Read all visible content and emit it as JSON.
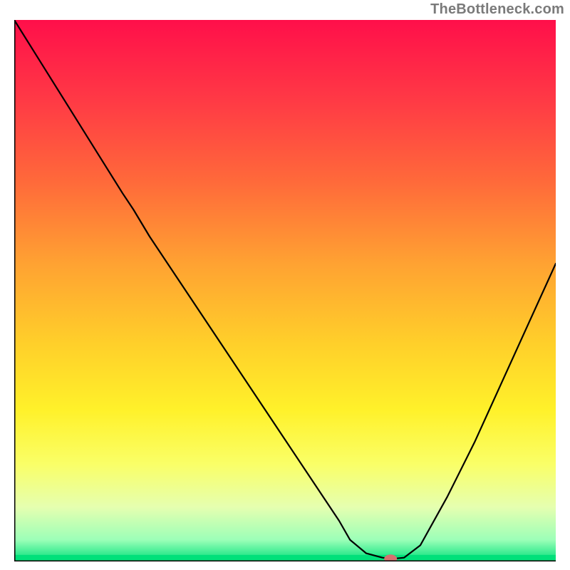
{
  "attribution": "TheBottleneck.com",
  "chart_data": {
    "type": "line",
    "title": "",
    "xlabel": "",
    "ylabel": "",
    "xlim": [
      0,
      100
    ],
    "ylim": [
      0,
      100
    ],
    "grid": false,
    "legend": false,
    "series": [
      {
        "name": "bottleneck-curve",
        "x": [
          0,
          5,
          10,
          15,
          20,
          22,
          25,
          30,
          35,
          40,
          45,
          50,
          55,
          60,
          62,
          65,
          68,
          70,
          72,
          75,
          80,
          85,
          90,
          95,
          100
        ],
        "y": [
          100,
          92,
          84,
          76,
          68,
          65,
          60,
          52.5,
          45,
          37.5,
          30,
          22.5,
          15,
          7.5,
          4,
          1.5,
          0.7,
          0.5,
          0.7,
          3,
          12,
          22,
          33,
          44,
          55
        ]
      }
    ],
    "marker": {
      "x": 69.5,
      "y": 0.5,
      "color": "#d4706f"
    },
    "gradient_stops": [
      {
        "offset": 0.0,
        "color": "#ff0f4a"
      },
      {
        "offset": 0.15,
        "color": "#ff3a45"
      },
      {
        "offset": 0.3,
        "color": "#ff6a3a"
      },
      {
        "offset": 0.45,
        "color": "#ffa232"
      },
      {
        "offset": 0.6,
        "color": "#ffd02a"
      },
      {
        "offset": 0.72,
        "color": "#fff12a"
      },
      {
        "offset": 0.82,
        "color": "#faff67"
      },
      {
        "offset": 0.9,
        "color": "#e5ffb0"
      },
      {
        "offset": 0.96,
        "color": "#9cffb8"
      },
      {
        "offset": 1.0,
        "color": "#00e07a"
      }
    ],
    "axes_color": "#000000",
    "line_color": "#000000",
    "line_width": 2.2,
    "marker_rx": 9,
    "marker_ry": 6,
    "green_band_height_frac": 0.012
  }
}
